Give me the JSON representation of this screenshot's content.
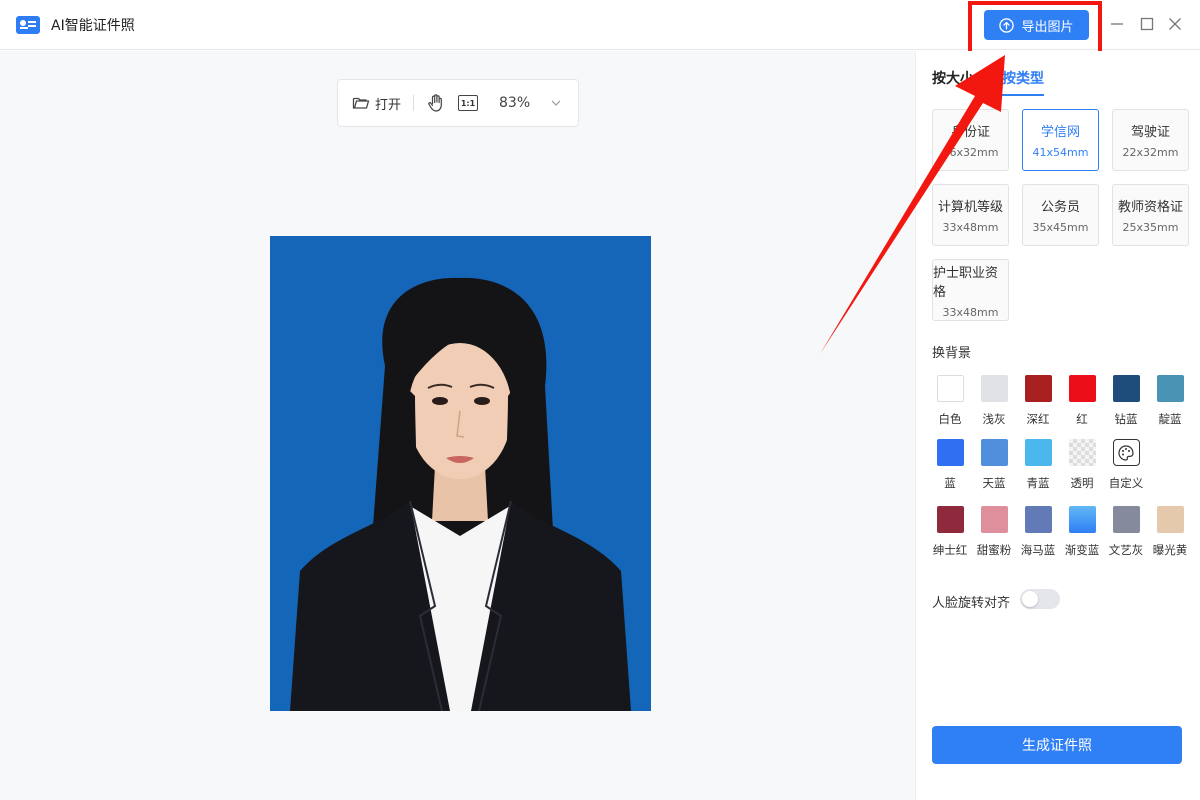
{
  "app": {
    "title": "AI智能证件照"
  },
  "header": {
    "export_label": "导出图片"
  },
  "toolbar": {
    "open_label": "打开",
    "ratio_label": "1:1",
    "zoom": "83%"
  },
  "tabs": [
    {
      "label": "按大小",
      "active": false
    },
    {
      "label": "按类型",
      "active": true
    }
  ],
  "sizes": [
    {
      "name": "身份证",
      "dims": "26x32mm",
      "selected": false
    },
    {
      "name": "学信网",
      "dims": "41x54mm",
      "selected": true
    },
    {
      "name": "驾驶证",
      "dims": "22x32mm",
      "selected": false
    },
    {
      "name": "计算机等级",
      "dims": "33x48mm",
      "selected": false
    },
    {
      "name": "公务员",
      "dims": "35x45mm",
      "selected": false
    },
    {
      "name": "教师资格证",
      "dims": "25x35mm",
      "selected": false
    },
    {
      "name": "护士职业资格",
      "dims": "33x48mm",
      "selected": false
    }
  ],
  "background": {
    "title": "换背景",
    "colors": [
      {
        "name": "白色",
        "color": "#ffffff"
      },
      {
        "name": "浅灰",
        "color": "#e1e2e6"
      },
      {
        "name": "深红",
        "color": "#a8201f"
      },
      {
        "name": "红",
        "color": "#ec0f1a"
      },
      {
        "name": "钻蓝",
        "color": "#1e4d7b"
      },
      {
        "name": "靛蓝",
        "color": "#4a93b4"
      },
      {
        "name": "蓝",
        "color": "#2f6ff2"
      },
      {
        "name": "天蓝",
        "color": "#4f8fdc"
      },
      {
        "name": "青蓝",
        "color": "#4bb7ec"
      },
      {
        "name": "透明",
        "color": "transparent"
      },
      {
        "name": "自定义",
        "color": "custom"
      },
      {
        "name": "绅士红",
        "color": "#8e2a3c"
      },
      {
        "name": "甜蜜粉",
        "color": "#de8f9b"
      },
      {
        "name": "海马蓝",
        "color": "#627ab5"
      },
      {
        "name": "渐变蓝",
        "color": "gradient"
      },
      {
        "name": "文艺灰",
        "color": "#868a9d"
      },
      {
        "name": "曝光黄",
        "color": "#e4c9ac"
      }
    ]
  },
  "face_align": {
    "label": "人脸旋转对齐",
    "enabled": false
  },
  "generate_label": "生成证件照",
  "photo": {
    "background_color": "#1567b9"
  }
}
